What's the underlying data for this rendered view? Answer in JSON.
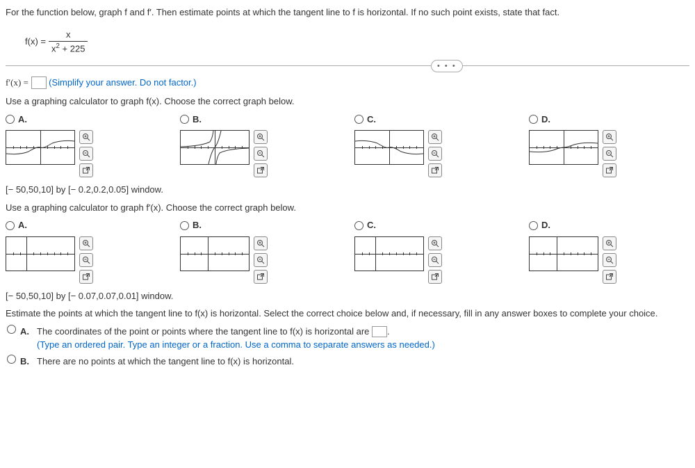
{
  "question": {
    "prompt": "For the function below, graph f and f′. Then estimate points at which the tangent line to f is horizontal. If no such point exists, state that fact.",
    "fx": "f(x) =",
    "num": "x",
    "den_pre": "x",
    "den_sup": "2",
    "den_post": " + 225"
  },
  "derivative": {
    "fpx": "f′(x) =",
    "hint": "(Simplify your answer. Do not factor.)"
  },
  "section1": {
    "instr": "Use a graphing calculator to graph f(x). Choose the correct graph below.",
    "opts": {
      "a": "A.",
      "b": "B.",
      "c": "C.",
      "d": "D."
    },
    "window": "[− 50,50,10] by [− 0.2,0.2,0.05] window."
  },
  "section2": {
    "instr": "Use a graphing calculator to graph f′(x). Choose the correct graph below.",
    "opts": {
      "a": "A.",
      "b": "B.",
      "c": "C.",
      "d": "D."
    },
    "window": "[− 50,50,10] by [− 0.07,0.07,0.01] window."
  },
  "final": {
    "instr": "Estimate the points at which the tangent line to f(x) is horizontal. Select the correct choice below and, if necessary, fill in any answer boxes to complete your choice.",
    "a_pre": "The coordinates of the point or points where the tangent line to f(x) is horizontal are ",
    "a_post": ".",
    "a_hint": "(Type an ordered pair. Type an integer or a fraction. Use a comma to separate answers as needed.)",
    "b": "There are no points at which the tangent line to f(x) is horizontal.",
    "la": "A.",
    "lb": "B."
  },
  "tools": {
    "zoomin": "zoom-in",
    "zoomout": "zoom-out",
    "open": "open-external"
  },
  "ellipsis": "• • •"
}
